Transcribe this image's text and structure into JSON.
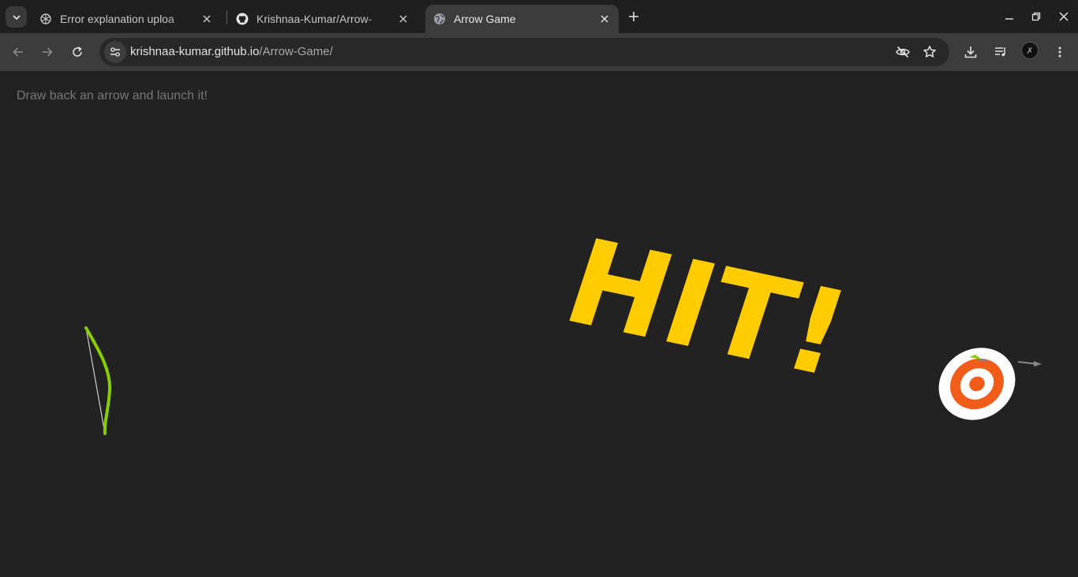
{
  "browser": {
    "tabs": [
      {
        "title": "Error explanation uploa",
        "icon": "chatgpt-icon",
        "active": false
      },
      {
        "title": "Krishnaa-Kumar/Arrow-",
        "icon": "github-icon",
        "active": false
      },
      {
        "title": "Arrow Game",
        "icon": "globe-icon",
        "active": true
      }
    ],
    "address": {
      "host": "krishnaa-kumar.github.io",
      "path": "/Arrow-Game/"
    },
    "profile_initial": "✗"
  },
  "game": {
    "instructions": "Draw back an arrow and launch it!",
    "hit_text": "HIT!",
    "colors": {
      "background": "#222222",
      "bow": "#88ce02",
      "hit_text": "#ffcc00",
      "target_outer": "#ffffff",
      "target_ring": "#f25c19"
    }
  }
}
